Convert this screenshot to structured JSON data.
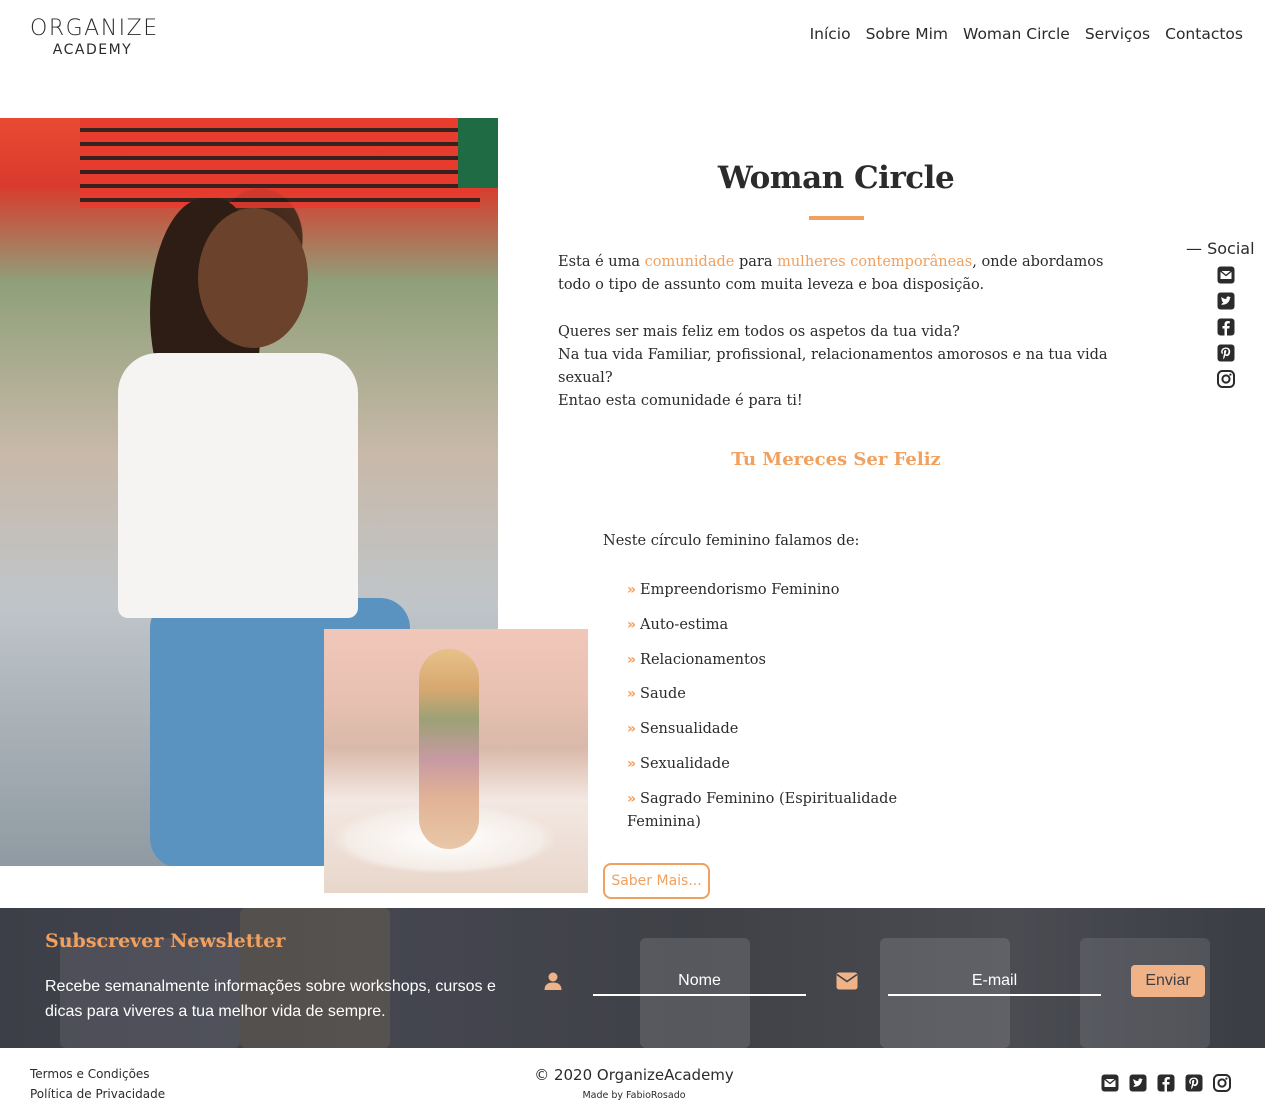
{
  "brand": {
    "line1": "ORGANIZE",
    "line2": "ACADEMY"
  },
  "nav": {
    "items": [
      {
        "label": "Início"
      },
      {
        "label": "Sobre Mim"
      },
      {
        "label": "Woman Circle"
      },
      {
        "label": "Serviços"
      },
      {
        "label": "Contactos"
      }
    ]
  },
  "main": {
    "title": "Woman Circle",
    "intro": {
      "before": "Esta é uma ",
      "accent1": "comunidade",
      "middle": " para ",
      "accent2": "mulheres contemporâneas",
      "after": ", onde abordamos todo o tipo de assunto com muita leveza e boa disposição."
    },
    "paragraph2": {
      "line1": "Queres ser mais feliz em todos os aspetos da tua vida?",
      "line2": "Na tua vida Familiar, profissional, relacionamentos amorosos e na tua vida sexual?",
      "line3": "Entao esta comunidade é para ti!"
    },
    "subtitle": "Tu Mereces Ser Feliz",
    "list_intro": "Neste círculo feminino falamos de:",
    "topics": [
      "Empreendorismo Feminino",
      "Auto-estima",
      "Relacionamentos",
      "Saude",
      "Sensualidade",
      "Sexualidade",
      "Sagrado Feminino (Espiritualidade Feminina)"
    ],
    "more_button": "Saber Mais..."
  },
  "social_sidebar": {
    "label": "— Social",
    "icons": [
      "envelope-icon",
      "twitter-icon",
      "facebook-icon",
      "pinterest-icon",
      "instagram-icon"
    ]
  },
  "newsletter": {
    "title": "Subscrever Newsletter",
    "text": "Recebe semanalmente informações sobre workshops, cursos e dicas para viveres a tua melhor vida de sempre.",
    "name_placeholder": "Nome",
    "email_placeholder": "E-mail",
    "send_label": "Enviar"
  },
  "footer": {
    "links": [
      "Termos e Condições",
      "Política de Privacidade"
    ],
    "copyright": "© 2020 OrganizeAcademy",
    "made_by": "Made by FabioRosado"
  },
  "colors": {
    "accent": "#f0a05f",
    "text": "#2b2b2b",
    "newsletter_bg": "#3f4148"
  }
}
